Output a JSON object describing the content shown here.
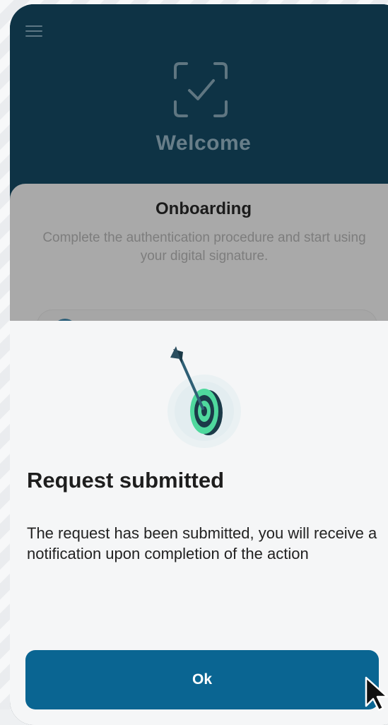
{
  "header": {
    "menu_icon": "hamburger-menu-icon",
    "logo_icon": "checkbox-check-icon",
    "title": "Welcome"
  },
  "onboarding": {
    "title": "Onboarding",
    "description": "Complete the authentication procedure and start using your digital signature."
  },
  "dialog": {
    "illustration": "target-with-arrow",
    "title": "Request submitted",
    "message": "The request has been submitted, you will receive a notification upon completion of the action",
    "ok_label": "Ok"
  },
  "colors": {
    "header_bg": "#0e3345",
    "button_bg": "#0a6592",
    "accent_green": "#49d49a"
  }
}
